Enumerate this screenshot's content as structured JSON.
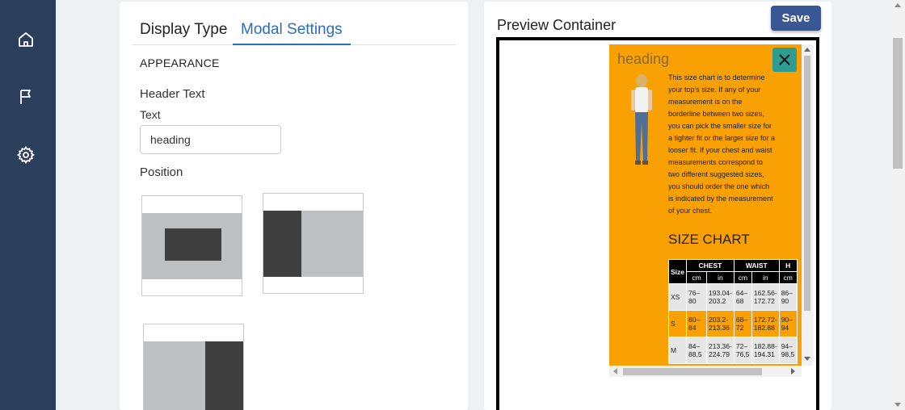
{
  "sidebar": {
    "items": [
      {
        "icon": "home-icon",
        "label": ""
      },
      {
        "icon": "flag-icon",
        "label": ""
      },
      {
        "icon": "gear-icon",
        "label": ""
      }
    ]
  },
  "tabs": [
    {
      "label": "Display Type",
      "active": false
    },
    {
      "label": "Modal Settings",
      "active": true
    }
  ],
  "settings": {
    "section_title": "APPEARANCE",
    "header_text_title": "Header Text",
    "text_label": "Text",
    "text_value": "heading",
    "position_label": "Position",
    "positions": [
      "center",
      "left",
      "right"
    ]
  },
  "preview": {
    "title": "Preview Container",
    "save_label": "Save",
    "modal": {
      "heading": "heading",
      "description_lines": [
        "This size chart is to determine",
        "your top's size. If any of your",
        "measurement is on the",
        "borderline between two sizes,",
        "you can pick the smaller size for",
        "a tighter fit or the larger size for a",
        "looser fit. If your chest and waist",
        "measurements correspond to",
        "two different suggested sizes,",
        "you should order the one which",
        "is indicated by the measurement",
        "of your chest."
      ],
      "size_chart_title": "SIZE CHART",
      "table": {
        "size_header": "Size",
        "group_headers": [
          "CHEST",
          "WAIST",
          "H"
        ],
        "unit_headers": [
          "cm",
          "in",
          "cm",
          "in",
          "cm"
        ],
        "rows": [
          {
            "size": "XS",
            "cells": [
              "76–80",
              "193.04-203.2",
              "64–68",
              "162.56-172.72",
              "86–90"
            ]
          },
          {
            "size": "S",
            "cells": [
              "80–84",
              "203.2-213.36",
              "68–72",
              "172.72-182.88",
              "90–94"
            ]
          },
          {
            "size": "M",
            "cells": [
              "84–88,5",
              "213.36-224.79",
              "72–76,5",
              "182.88-194.31",
              "94–98,5"
            ]
          }
        ]
      }
    }
  },
  "colors": {
    "sidebar": "#2b3f5c",
    "accent": "#2a6ebb",
    "save": "#3a5795",
    "modal_bg": "#f9a003",
    "close_bg": "#2e9c8f"
  }
}
